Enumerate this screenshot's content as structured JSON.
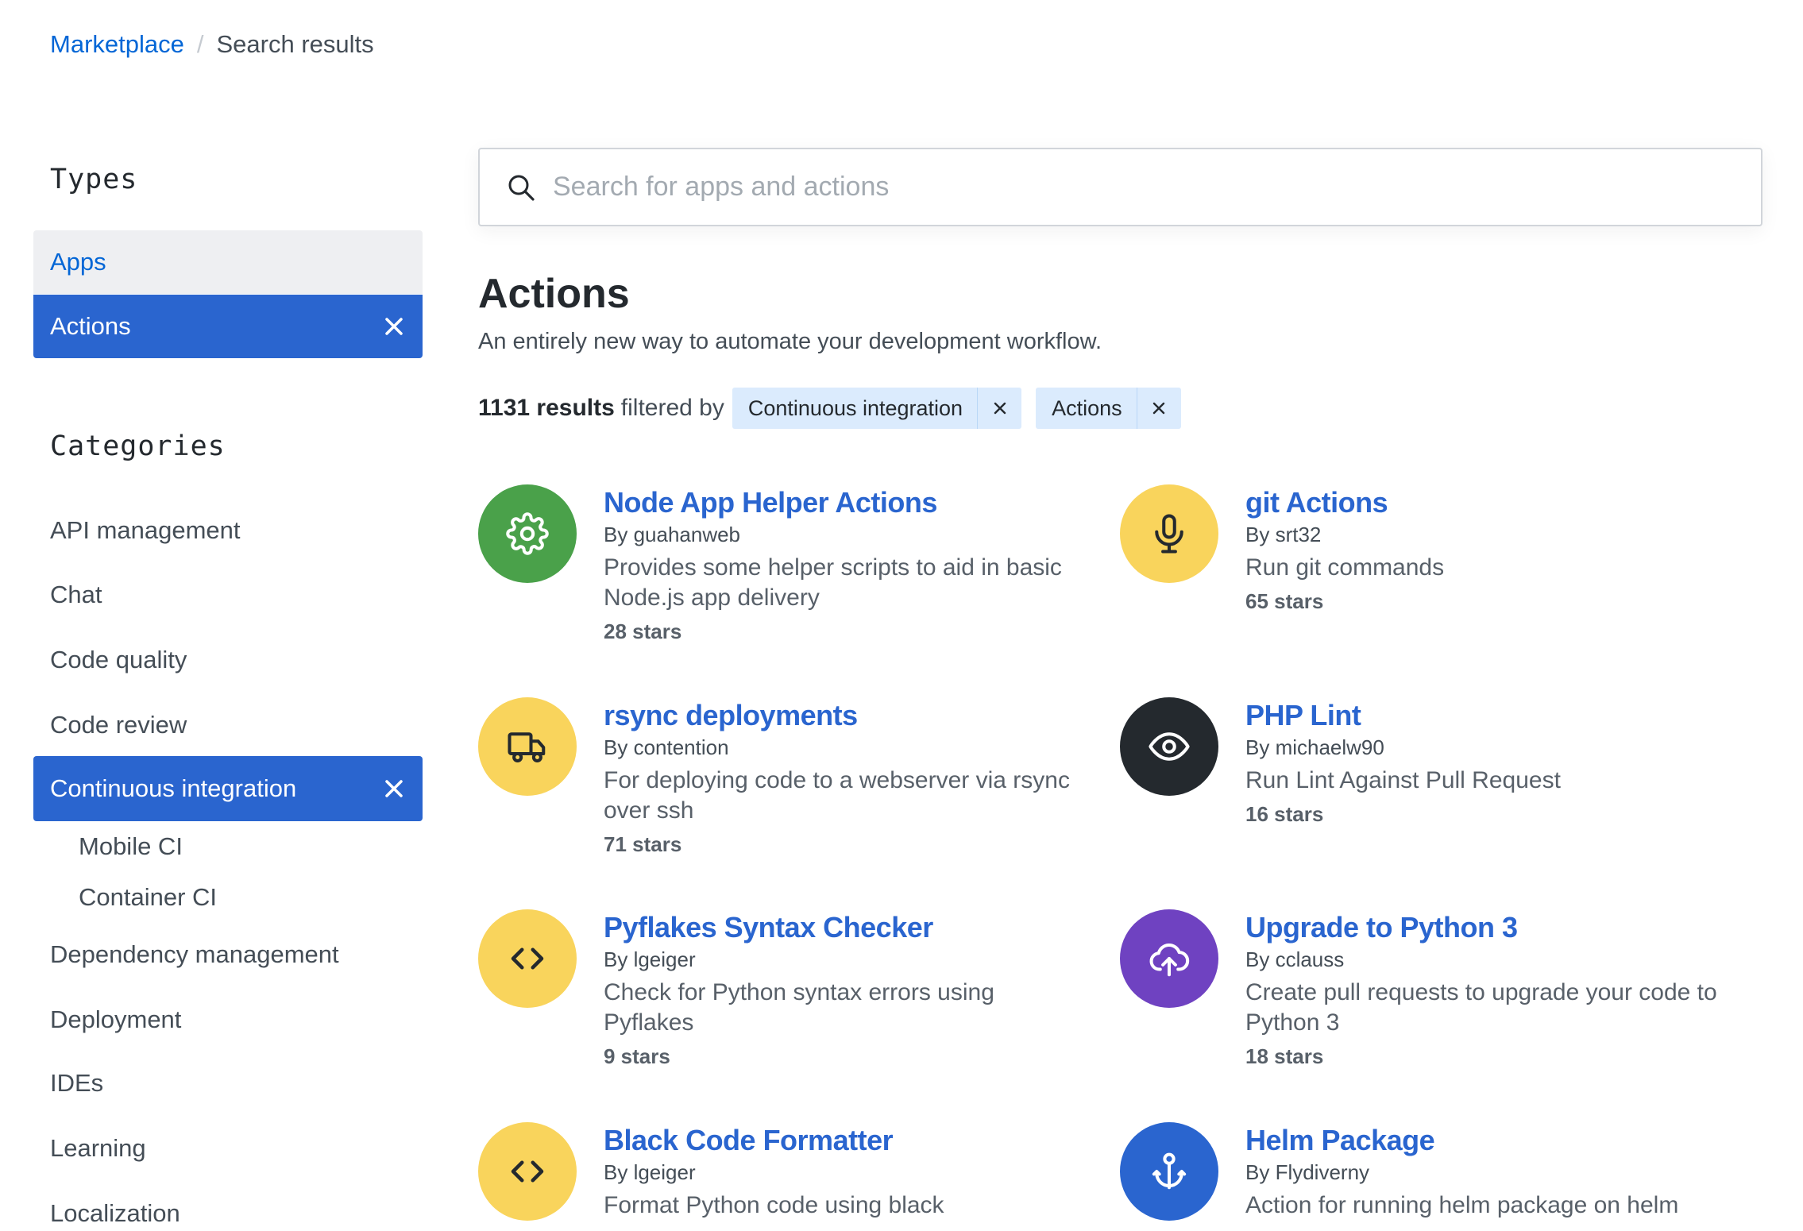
{
  "breadcrumb": {
    "root": "Marketplace",
    "separator": "/",
    "current": "Search results"
  },
  "sidebar": {
    "types_heading": "Types",
    "types": [
      {
        "label": "Apps",
        "selected": false
      },
      {
        "label": "Actions",
        "selected": true
      }
    ],
    "categories_heading": "Categories",
    "categories": [
      {
        "label": "API management"
      },
      {
        "label": "Chat"
      },
      {
        "label": "Code quality"
      },
      {
        "label": "Code review"
      },
      {
        "label": "Continuous integration",
        "selected": true
      },
      {
        "label": "Mobile CI",
        "sub": true
      },
      {
        "label": "Container CI",
        "sub": true
      },
      {
        "label": "Dependency management"
      },
      {
        "label": "Deployment"
      },
      {
        "label": "IDEs"
      },
      {
        "label": "Learning"
      },
      {
        "label": "Localization"
      }
    ]
  },
  "search": {
    "placeholder": "Search for apps and actions",
    "value": ""
  },
  "main": {
    "title": "Actions",
    "subtitle": "An entirely new way to automate your development workflow.",
    "results_count": "1131 results",
    "filtered_by": "filtered by",
    "filters": [
      {
        "label": "Continuous integration"
      },
      {
        "label": "Actions"
      }
    ]
  },
  "colors": {
    "accent": "#2a65cf",
    "link": "#0366d6",
    "green": "#4aa14a",
    "yellow": "#f9d45c",
    "dark": "#24292e",
    "purple": "#6f42c1",
    "blue": "#2a65cf"
  },
  "actions": [
    {
      "name": "Node App Helper Actions",
      "by": "By guahanweb",
      "description": "Provides some helper scripts to aid in basic Node.js app delivery",
      "stars": "28 stars",
      "icon": "gear-icon",
      "color": "#4aa14a"
    },
    {
      "name": "git Actions",
      "by": "By srt32",
      "description": "Run git commands",
      "stars": "65 stars",
      "icon": "microphone-icon",
      "color": "#f9d45c"
    },
    {
      "name": "rsync deployments",
      "by": "By contention",
      "description": "For deploying code to a webserver via rsync over ssh",
      "stars": "71 stars",
      "icon": "truck-icon",
      "color": "#f9d45c"
    },
    {
      "name": "PHP Lint",
      "by": "By michaelw90",
      "description": "Run Lint Against Pull Request",
      "stars": "16 stars",
      "icon": "eye-icon",
      "color": "#24292e"
    },
    {
      "name": "Pyflakes Syntax Checker",
      "by": "By lgeiger",
      "description": "Check for Python syntax errors using Pyflakes",
      "stars": "9 stars",
      "icon": "code-icon",
      "color": "#f9d45c"
    },
    {
      "name": "Upgrade to Python 3",
      "by": "By cclauss",
      "description": "Create pull requests to upgrade your code to Python 3",
      "stars": "18 stars",
      "icon": "cloud-upload-icon",
      "color": "#6f42c1"
    },
    {
      "name": "Black Code Formatter",
      "by": "By lgeiger",
      "description": "Format Python code using black",
      "stars": "",
      "icon": "code-icon",
      "color": "#f9d45c"
    },
    {
      "name": "Helm Package",
      "by": "By Flydiverny",
      "description": "Action for running helm package on helm",
      "stars": "",
      "icon": "anchor-icon",
      "color": "#2a65cf"
    }
  ]
}
